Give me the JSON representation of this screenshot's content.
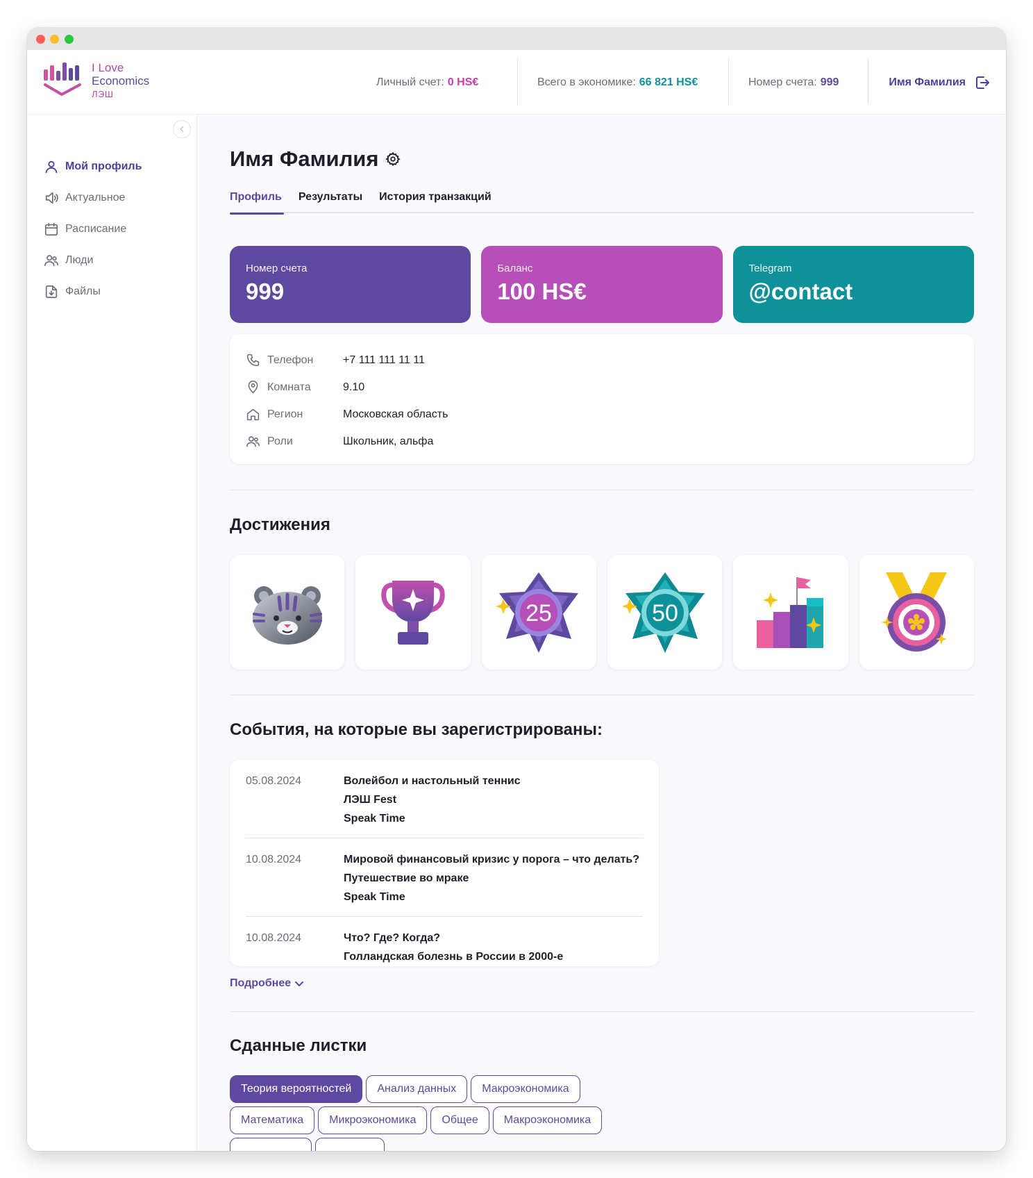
{
  "brand": {
    "line1": "I Love",
    "line2": "Economics",
    "line3": "ЛЭШ",
    "colors": {
      "purple": "#5d4aa0",
      "magenta": "#b64fb7",
      "teal": "#0e9199"
    }
  },
  "header": {
    "personal_label": "Личный счет:",
    "personal_value": "0 HS€",
    "economy_label": "Всего в экономике:",
    "economy_value": "66 821 HS€",
    "account_label": "Номер счета:",
    "account_value": "999",
    "user_name": "Имя Фамилия"
  },
  "sidebar": {
    "items": [
      {
        "label": "Мой профиль",
        "icon": "user-icon",
        "active": true
      },
      {
        "label": "Актуальное",
        "icon": "speaker-icon"
      },
      {
        "label": "Расписание",
        "icon": "calendar-icon"
      },
      {
        "label": "Люди",
        "icon": "people-icon"
      },
      {
        "label": "Файлы",
        "icon": "file-download-icon"
      }
    ]
  },
  "profile": {
    "name": "Имя Фамилия",
    "tabs": [
      "Профиль",
      "Результаты",
      "История транзакций"
    ],
    "cards": [
      {
        "label": "Номер счета",
        "value": "999"
      },
      {
        "label": "Баланс",
        "value": "100 HS€"
      },
      {
        "label": "Telegram",
        "value": "@contact"
      }
    ],
    "info": [
      {
        "label": "Телефон",
        "value": "+7 111 111 11 11",
        "icon": "phone-icon"
      },
      {
        "label": "Комната",
        "value": "9.10",
        "icon": "location-pin-icon"
      },
      {
        "label": "Регион",
        "value": "Московская область",
        "icon": "home-icon"
      },
      {
        "label": "Роли",
        "value": "Школьник, альфа",
        "icon": "people-icon"
      }
    ]
  },
  "achievements": {
    "title": "Достижения",
    "badges": [
      {
        "icon": "tiger-icon"
      },
      {
        "icon": "trophy-icon"
      },
      {
        "icon": "badge-25-icon",
        "number": "25"
      },
      {
        "icon": "badge-50-icon",
        "number": "50"
      },
      {
        "icon": "podium-icon"
      },
      {
        "icon": "medal-icon"
      }
    ]
  },
  "events": {
    "title": "События, на которые вы зарегистрированы:",
    "items": [
      {
        "date": "05.08.2024",
        "titles": [
          "Волейбол и настольный теннис",
          "ЛЭШ Fest",
          "Speak Time"
        ]
      },
      {
        "date": "10.08.2024",
        "titles": [
          "Мировой финансовый кризис у порога – что делать?",
          "Путешествие во мраке",
          "Speak Time"
        ]
      },
      {
        "date": "10.08.2024",
        "titles": [
          "Что? Где? Когда?",
          "Голландская болезнь в России в 2000-е"
        ]
      }
    ],
    "more_label": "Подробнее"
  },
  "sheets": {
    "title": "Сданные листки",
    "chips_row1": [
      "Теория вероятностей",
      "Анализ данных",
      "Макроэкономика"
    ],
    "chips_row2": [
      "Математика",
      "Микроэкономика",
      "Общее",
      "Макроэкономика"
    ]
  }
}
